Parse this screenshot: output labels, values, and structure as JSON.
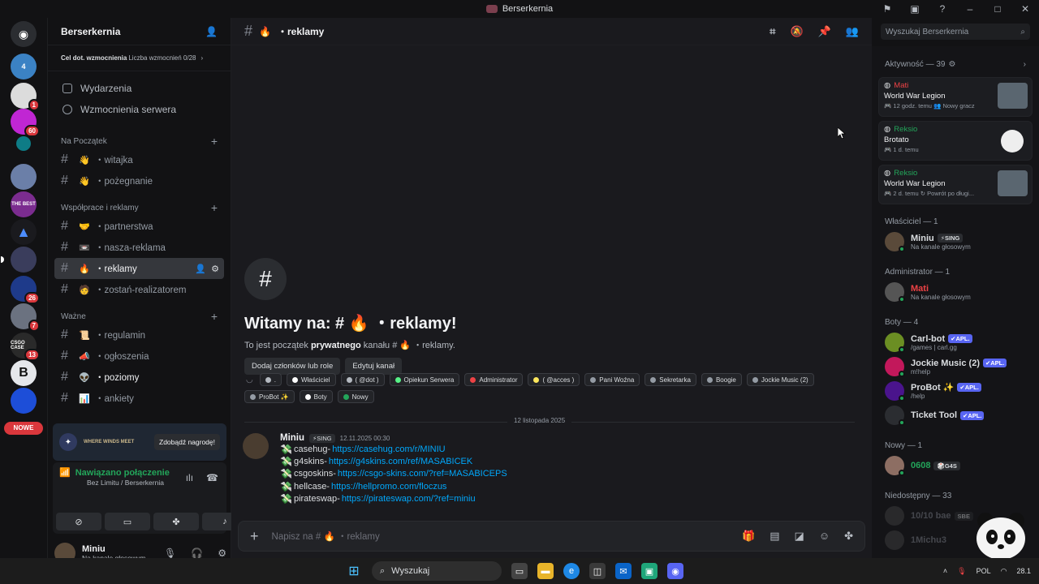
{
  "window": {
    "title": "Berserkernia"
  },
  "guild_badges": [
    "1",
    "60",
    "26",
    "7",
    "13"
  ],
  "guild_labels": {
    "g2": "4",
    "g6": "THE BEST",
    "g12": "CSGO CASE",
    "g13": "B"
  },
  "nowe": "NOWE",
  "server": {
    "name": "Berserkernia",
    "boost_goal": "Cel dot. wzmocnienia",
    "boost_count": "Liczba wzmocnień 0/28"
  },
  "nav": [
    "Wydarzenia",
    "Wzmocnienia serwera"
  ],
  "categories": [
    {
      "name": "Na Początek",
      "channels": [
        {
          "emoji": "👋",
          "name": "・witajka"
        },
        {
          "emoji": "👋",
          "name": "・pożegnanie"
        }
      ]
    },
    {
      "name": "Współprace i reklamy",
      "channels": [
        {
          "emoji": "🤝",
          "name": "・partnerstwa"
        },
        {
          "emoji": "📼",
          "name": "・nasza-reklama"
        },
        {
          "emoji": "🔥",
          "name": "・reklamy"
        },
        {
          "emoji": "🧑",
          "name": "・zostań-realizatorem"
        }
      ]
    },
    {
      "name": "Ważne",
      "channels": [
        {
          "emoji": "📜",
          "name": "・regulamin"
        },
        {
          "emoji": "📣",
          "name": "・ogłoszenia"
        },
        {
          "emoji": "👽",
          "name": "・poziomy"
        },
        {
          "emoji": "📊",
          "name": "・ankiety"
        }
      ]
    }
  ],
  "promo": {
    "brand": "WHERE WINDS MEET",
    "button": "Zdobądź nagrodę!"
  },
  "voice": {
    "status": "Nawiązano połączenie",
    "sub": "Bez Limitu / Berserkernia"
  },
  "user": {
    "name": "Miniu",
    "status": "Na kanale głosowym"
  },
  "channel": {
    "title": "・reklamy",
    "emoji": "🔥"
  },
  "welcome": {
    "title": "Witamy na: # 🔥 ・reklamy!",
    "sub_prefix": "To jest początek ",
    "sub_bold": "prywatnego",
    "sub_suffix": " kanału # 🔥 ・reklamy.",
    "btn_add": "Dodaj członków lub role",
    "btn_edit": "Edytuj kanał"
  },
  "roles": [
    {
      "name": ".",
      "color": "#b5bac1"
    },
    {
      "name": "Właściciel",
      "color": "#ffffff"
    },
    {
      "name": "( @dot )",
      "color": "#b5bac1"
    },
    {
      "name": "Opiekun Serwera",
      "color": "#57f287"
    },
    {
      "name": "Administrator",
      "color": "#ed4245"
    },
    {
      "name": "( @acces )",
      "color": "#fee75c"
    },
    {
      "name": "Pani Woźna",
      "color": "#949ba4"
    },
    {
      "name": "Sekretarka",
      "color": "#949ba4"
    },
    {
      "name": "Boogie",
      "color": "#949ba4"
    },
    {
      "name": "Jockie Music (2)",
      "color": "#949ba4"
    },
    {
      "name": "ProBot ✨",
      "color": "#949ba4"
    },
    {
      "name": "Boty",
      "color": "#ffffff"
    },
    {
      "name": "Nowy",
      "color": "#23a55a"
    }
  ],
  "date_divider": "12 listopada 2025",
  "message": {
    "author": "Miniu",
    "tag": "⚡SING",
    "time": "12.11.2025 00:30",
    "lines": [
      {
        "label": "casehug- ",
        "link": "https://casehug.com/r/MINIU"
      },
      {
        "label": "g4skins- ",
        "link": "https://g4skins.com/ref/MASABICEK"
      },
      {
        "label": "csgoskins- ",
        "link": "https://csgo-skins.com/?ref=MASABICEPS"
      },
      {
        "label": "hellcase- ",
        "link": "https://hellpromo.com/floczus"
      },
      {
        "label": "pirateswap- ",
        "link": "https://pirateswap.com/?ref=miniu"
      }
    ]
  },
  "composer": {
    "placeholder": "Napisz na # 🔥 ・reklamy"
  },
  "search": {
    "placeholder": "Wyszukaj Berserkernia"
  },
  "members": {
    "activity_header": "Aktywność — 39",
    "activities": [
      {
        "name": "Mati",
        "name_color": "#ed4245",
        "game": "World War Legion",
        "meta": "🎮 12 godz. temu  👥 Nowy gracz"
      },
      {
        "name": "Reksio",
        "name_color": "#23a55a",
        "game": "Brotato",
        "meta": "🎮 1 d. temu"
      },
      {
        "name": "Reksio",
        "name_color": "#23a55a",
        "game": "World War Legion",
        "meta": "🎮 2 d. temu  ↻ Powrót po długi..."
      }
    ],
    "groups": [
      {
        "header": "Właściciel — 1",
        "members": [
          {
            "name": "Miniu",
            "color": "#f2f3f5",
            "tag": "⚡SING",
            "sub": "Na kanale głosowym"
          }
        ]
      },
      {
        "header": "Administrator — 1",
        "members": [
          {
            "name": "Mati",
            "color": "#ed4245",
            "sub": "Na kanale głosowym"
          }
        ]
      },
      {
        "header": "Boty — 4",
        "members": [
          {
            "name": "Carl-bot",
            "color": "#f2f3f5",
            "apl": "✔APL.",
            "sub": "/games | carl.gg"
          },
          {
            "name": "Jockie Music (2)",
            "color": "#f2f3f5",
            "apl": "✔APL.",
            "sub": "m!help"
          },
          {
            "name": "ProBot ✨",
            "color": "#f2f3f5",
            "apl": "✔APL.",
            "sub": "/help"
          },
          {
            "name": "Ticket Tool",
            "color": "#f2f3f5",
            "apl": "✔APL.",
            "sub": ""
          }
        ]
      },
      {
        "header": "Nowy — 1",
        "members": [
          {
            "name": "0608",
            "color": "#23a55a",
            "tag": "🎲G4S",
            "sub": ""
          }
        ]
      },
      {
        "header": "Niedostępny — 33",
        "members": [
          {
            "name": "10/10 bae",
            "color": "#4e5058",
            "tag": "SBE",
            "sub": ""
          },
          {
            "name": "1Michu3",
            "color": "#4e5058",
            "sub": ""
          }
        ]
      }
    ]
  },
  "taskbar": {
    "search": "Wyszukaj",
    "lang": "POL",
    "date": "28.1"
  }
}
